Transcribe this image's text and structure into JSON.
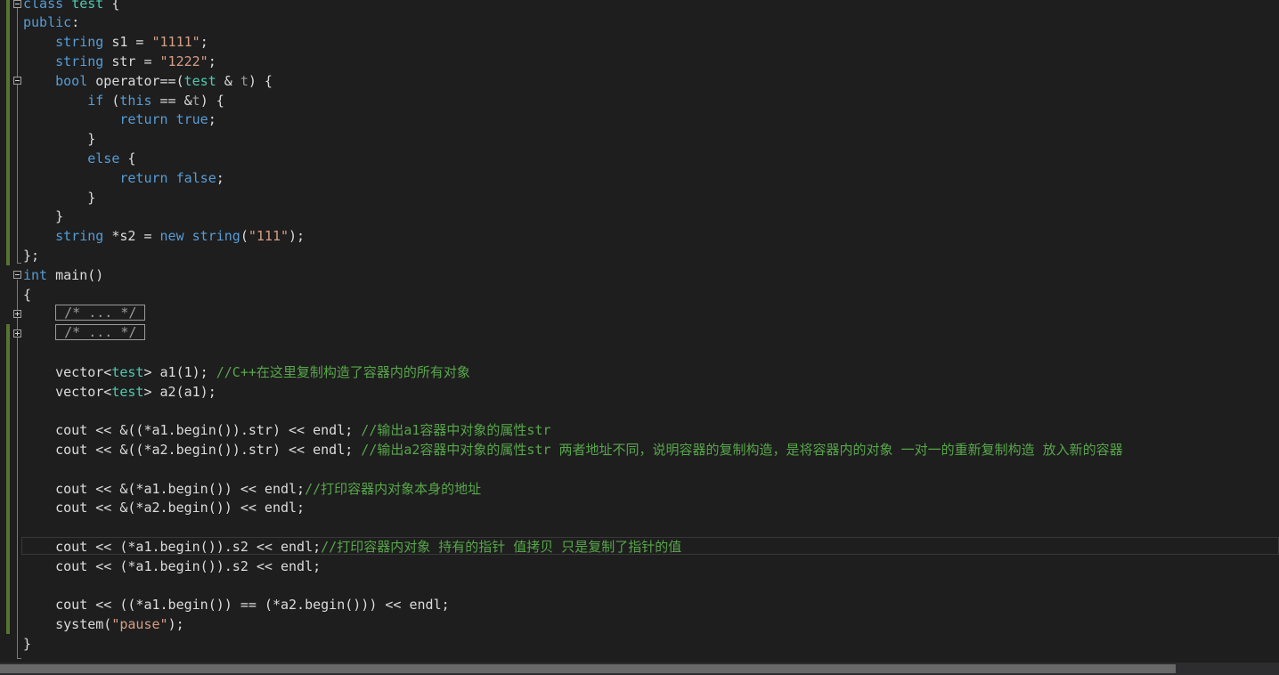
{
  "code": {
    "class_kw": "class",
    "class_name": "test",
    "open_brace": "{",
    "public_kw": "public",
    "colon": ":",
    "string_kw": "string",
    "s1_decl": " s1 = ",
    "s1_val": "\"1111\"",
    "semi": ";",
    "str_decl": " str = ",
    "str_val": "\"1222\"",
    "bool_kw": "bool",
    "op_decl": " operator==(",
    "param_type": "test",
    "param_amp": " & ",
    "param_name": "t",
    "op_tail": ") {",
    "if_kw": "if",
    "if_paren": " (",
    "this_kw": "this",
    "if_cmp": " == &",
    "if_t": "t",
    "if_tail": ") {",
    "return_kw": "return",
    "true_kw": "true",
    "false_kw": "false",
    "close_brace": "}",
    "else_kw": "else",
    "else_tail": " {",
    "s2_star": " *s2 = ",
    "new_kw": "new",
    "string_type": "string",
    "paren_open": "(",
    "s2_val": "\"111\"",
    "s2_tail": ");",
    "class_end": "};",
    "int_kw": "int",
    "main_sig": " main()",
    "collapsed_1": "/* ... */",
    "collapsed_2": "/* ... */",
    "vector_1": "vector<",
    "test_1": "test",
    "vector_1_tail": "> a1(1); ",
    "comment_1": "//C++在这里复制构造了容器内的所有对象",
    "vector_2": "vector<",
    "test_2": "test",
    "vector_2_tail": "> a2(a1);",
    "cout_1": "cout << &((*a1.begin()).str) << endl; ",
    "comment_2": "//输出a1容器中对象的属性str",
    "cout_2": "cout << &((*a2.begin()).str) << endl; ",
    "comment_3": "//输出a2容器中对象的属性str 两者地址不同，说明容器的复制构造，是将容器内的对象 一对一的重新复制构造 放入新的容器",
    "cout_3": "cout << &(*a1.begin()) << endl;",
    "comment_4": "//打印容器内对象本身的地址",
    "cout_4": "cout << &(*a2.begin()) << endl;",
    "cout_5": "cout << (*a1.begin()).s2 << endl;",
    "comment_5": "//打印容器内对象 持有的指针 值拷贝 只是复制了指针的值",
    "cout_6": "cout << (*a1.begin()).s2 << endl;",
    "cout_7": "cout << ((*a1.begin()) == (*a2.begin())) << endl;",
    "system_call": "system(",
    "pause_val": "\"pause\"",
    "system_tail": ");",
    "main_end": "}"
  },
  "colors": {
    "background": "#1e1e1e",
    "keyword": "#569cd6",
    "type": "#4ec9b0",
    "string": "#d69d85",
    "comment": "#57a64a",
    "plain": "#dcdcdc",
    "change_bar": "#577430"
  },
  "icons": [
    "fold-collapse-icon",
    "fold-expand-icon"
  ]
}
